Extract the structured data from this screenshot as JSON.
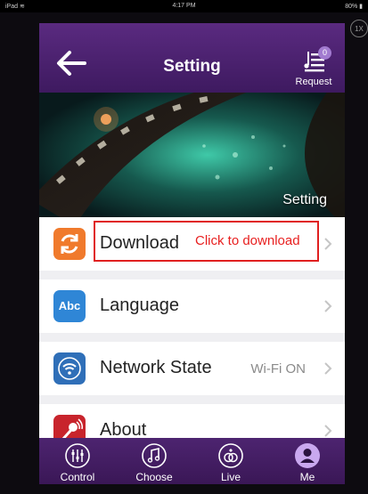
{
  "status_bar": {
    "device": "iPad",
    "time": "4:17 PM",
    "battery": "80%"
  },
  "zoom_badge": "1X",
  "header": {
    "title": "Setting",
    "request_label": "Request",
    "request_count": "0"
  },
  "banner": {
    "caption": "Setting"
  },
  "menu": {
    "download": {
      "label": "Download",
      "hint": "Click to download"
    },
    "language": {
      "label": "Language",
      "icon_text": "Abc"
    },
    "network": {
      "label": "Network State",
      "value": "Wi-Fi ON"
    },
    "about": {
      "label": "About"
    }
  },
  "tabs": {
    "control": "Control",
    "choose": "Choose",
    "live": "Live",
    "me": "Me"
  },
  "colors": {
    "header": "#4a2070",
    "download_icon": "#f07a2c",
    "language_icon": "#2f86d6",
    "network_icon": "#2f6fb8",
    "about_icon": "#c8242c",
    "highlight": "#e02020"
  }
}
